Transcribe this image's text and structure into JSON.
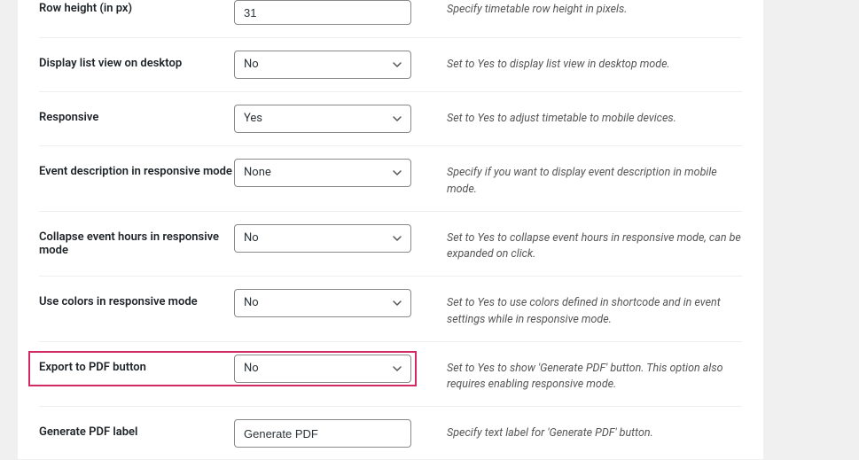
{
  "settings": {
    "row_height": {
      "label": "Row height (in px)",
      "value": "31",
      "desc": "Specify timetable row height in pixels."
    },
    "display_list_desktop": {
      "label": "Display list view on desktop",
      "value": "No",
      "desc": "Set to Yes to display list view in desktop mode."
    },
    "responsive": {
      "label": "Responsive",
      "value": "Yes",
      "desc": "Set to Yes to adjust timetable to mobile devices."
    },
    "event_desc_responsive": {
      "label": "Event description in responsive mode",
      "value": "None",
      "desc": "Specify if you want to display event description in mobile mode."
    },
    "collapse_event_hours": {
      "label": "Collapse event hours in responsive mode",
      "value": "No",
      "desc": "Set to Yes to collapse event hours in responsive mode, can be expanded on click."
    },
    "use_colors_responsive": {
      "label": "Use colors in responsive mode",
      "value": "No",
      "desc": "Set to Yes to use colors defined in shortcode and in event settings while in responsive mode."
    },
    "export_pdf": {
      "label": "Export to PDF button",
      "value": "No",
      "desc": "Set to Yes to show 'Generate PDF' button. This option also requires enabling responsive mode."
    },
    "generate_pdf_label": {
      "label": "Generate PDF label",
      "value": "Generate PDF",
      "desc": "Specify text label for 'Generate PDF' button."
    }
  }
}
